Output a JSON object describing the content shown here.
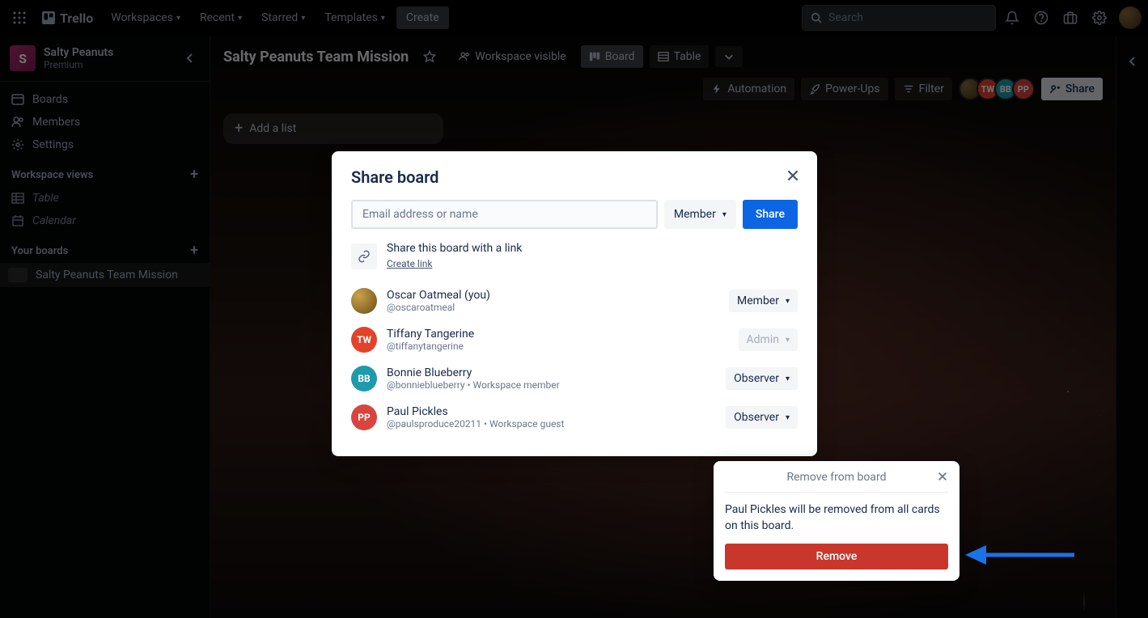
{
  "topnav": {
    "logo_text": "Trello",
    "menus": [
      "Workspaces",
      "Recent",
      "Starred",
      "Templates"
    ],
    "create_label": "Create",
    "search_placeholder": "Search"
  },
  "sidebar": {
    "workspace_initial": "S",
    "workspace_name": "Salty Peanuts",
    "workspace_plan": "Premium",
    "items": [
      {
        "label": "Boards"
      },
      {
        "label": "Members"
      },
      {
        "label": "Settings"
      }
    ],
    "views_heading": "Workspace views",
    "views": [
      {
        "label": "Table"
      },
      {
        "label": "Calendar"
      }
    ],
    "boards_heading": "Your boards",
    "boards": [
      {
        "label": "Salty Peanuts Team Mission"
      }
    ]
  },
  "board": {
    "title": "Salty Peanuts Team Mission",
    "visibility_label": "Workspace visible",
    "view_board": "Board",
    "view_table": "Table",
    "automation_label": "Automation",
    "powerups_label": "Power-Ups",
    "filter_label": "Filter",
    "share_label": "Share",
    "add_list_label": "Add a list",
    "member_avatars": [
      {
        "initials": "",
        "bg": "radial-gradient(circle at 30% 30%, #8a6d3b, #3a2f1a)"
      },
      {
        "initials": "TW",
        "bg": "#e2432a"
      },
      {
        "initials": "BB",
        "bg": "#1f9aaa"
      },
      {
        "initials": "PP",
        "bg": "#d9443f"
      }
    ]
  },
  "modal": {
    "title": "Share board",
    "input_placeholder": "Email address or name",
    "role_default": "Member",
    "share_button": "Share",
    "link_title": "Share this board with a link",
    "link_action": "Create link",
    "members": [
      {
        "name": "Oscar Oatmeal (you)",
        "sub": "@oscaroatmeal",
        "role": "Member",
        "initials": "",
        "bg": "radial-gradient(circle at 30% 30%, #c9a44a, #6a4b1a)",
        "disabled": false
      },
      {
        "name": "Tiffany Tangerine",
        "sub": "@tiffanytangerine",
        "role": "Admin",
        "initials": "TW",
        "bg": "#e2432a",
        "disabled": true
      },
      {
        "name": "Bonnie Blueberry",
        "sub": "@bonnieblueberry • Workspace member",
        "role": "Observer",
        "initials": "BB",
        "bg": "#1f9aaa",
        "disabled": false
      },
      {
        "name": "Paul Pickles",
        "sub": "@paulsproduce20211 • Workspace guest",
        "role": "Observer",
        "initials": "PP",
        "bg": "#d9443f",
        "disabled": false
      }
    ]
  },
  "popover": {
    "title": "Remove from board",
    "body": "Paul Pickles will be removed from all cards on this board.",
    "button": "Remove"
  }
}
